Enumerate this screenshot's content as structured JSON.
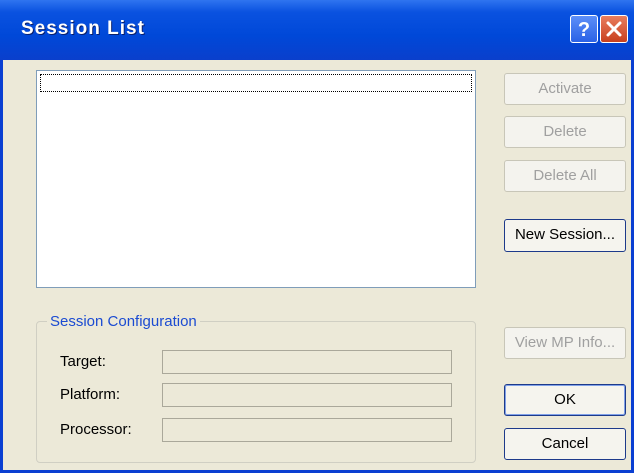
{
  "window": {
    "title": "Session List"
  },
  "buttons": {
    "activate": "Activate",
    "delete": "Delete",
    "delete_all": "Delete All",
    "new_session": "New Session...",
    "view_mp_info": "View MP Info...",
    "ok": "OK",
    "cancel": "Cancel"
  },
  "session_configuration": {
    "legend": "Session Configuration",
    "fields": [
      {
        "label": "Target:",
        "value": ""
      },
      {
        "label": "Platform:",
        "value": ""
      },
      {
        "label": "Processor:",
        "value": ""
      }
    ]
  },
  "icons": {
    "help": "help-icon",
    "close": "close-icon"
  },
  "colors": {
    "titlebar": "#0048d8",
    "legend": "#1b4bd2",
    "face": "#ece9d8"
  }
}
